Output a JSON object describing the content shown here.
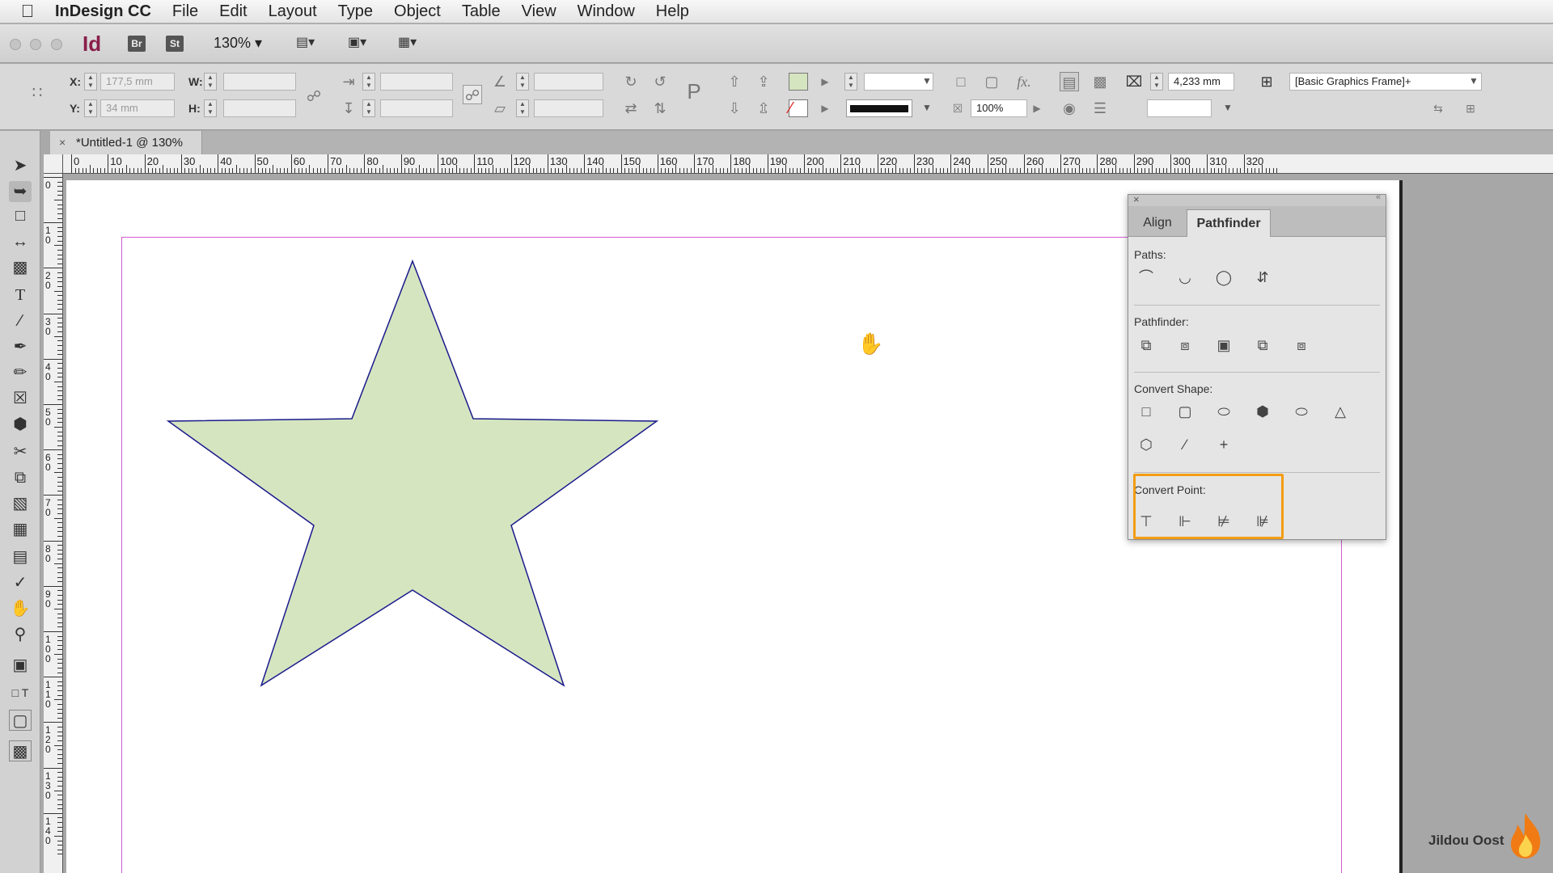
{
  "menubar": {
    "apple": "",
    "app_name": "InDesign CC",
    "items": [
      "File",
      "Edit",
      "Layout",
      "Type",
      "Object",
      "Table",
      "View",
      "Window",
      "Help"
    ]
  },
  "appbar": {
    "logo": "Id",
    "bridge": "Br",
    "stock": "St",
    "zoom": "130%"
  },
  "control": {
    "x_label": "X:",
    "x_value": "177,5 mm",
    "y_label": "Y:",
    "y_value": "34 mm",
    "w_label": "W:",
    "h_label": "H:",
    "stroke_weight": "4,233 mm",
    "opacity": "100%",
    "object_style": "[Basic Graphics Frame]+",
    "fill_color": "#d5e5c0"
  },
  "document": {
    "tab_title": "*Untitled-1 @ 130%",
    "close": "×"
  },
  "rulers": {
    "horizontal": [
      "0",
      "10",
      "20",
      "30",
      "40",
      "50",
      "60",
      "70",
      "80",
      "90",
      "100",
      "110",
      "120",
      "130",
      "140",
      "150",
      "160",
      "170",
      "180",
      "190",
      "200",
      "210",
      "220",
      "230",
      "240",
      "250",
      "260",
      "270",
      "280",
      "290",
      "300",
      "310",
      "320"
    ],
    "vertical": [
      "0",
      "1 0",
      "2 0",
      "3 0",
      "4 0",
      "5 0",
      "6 0",
      "7 0",
      "8 0",
      "9 0",
      "1 0 0",
      "1 1 0",
      "1 2 0",
      "1 3 0",
      "1 4 0"
    ]
  },
  "star": {
    "fill": "#d5e5c0",
    "stroke": "#1a1a8c"
  },
  "pathfinder_panel": {
    "tabs": [
      "Align",
      "Pathfinder"
    ],
    "active_tab": "Pathfinder",
    "sections": {
      "paths": "Paths:",
      "pathfinder": "Pathfinder:",
      "convert_shape": "Convert Shape:",
      "convert_point": "Convert Point:"
    },
    "highlight_color": "#f39c12"
  },
  "watermark": "Jildou Oost"
}
